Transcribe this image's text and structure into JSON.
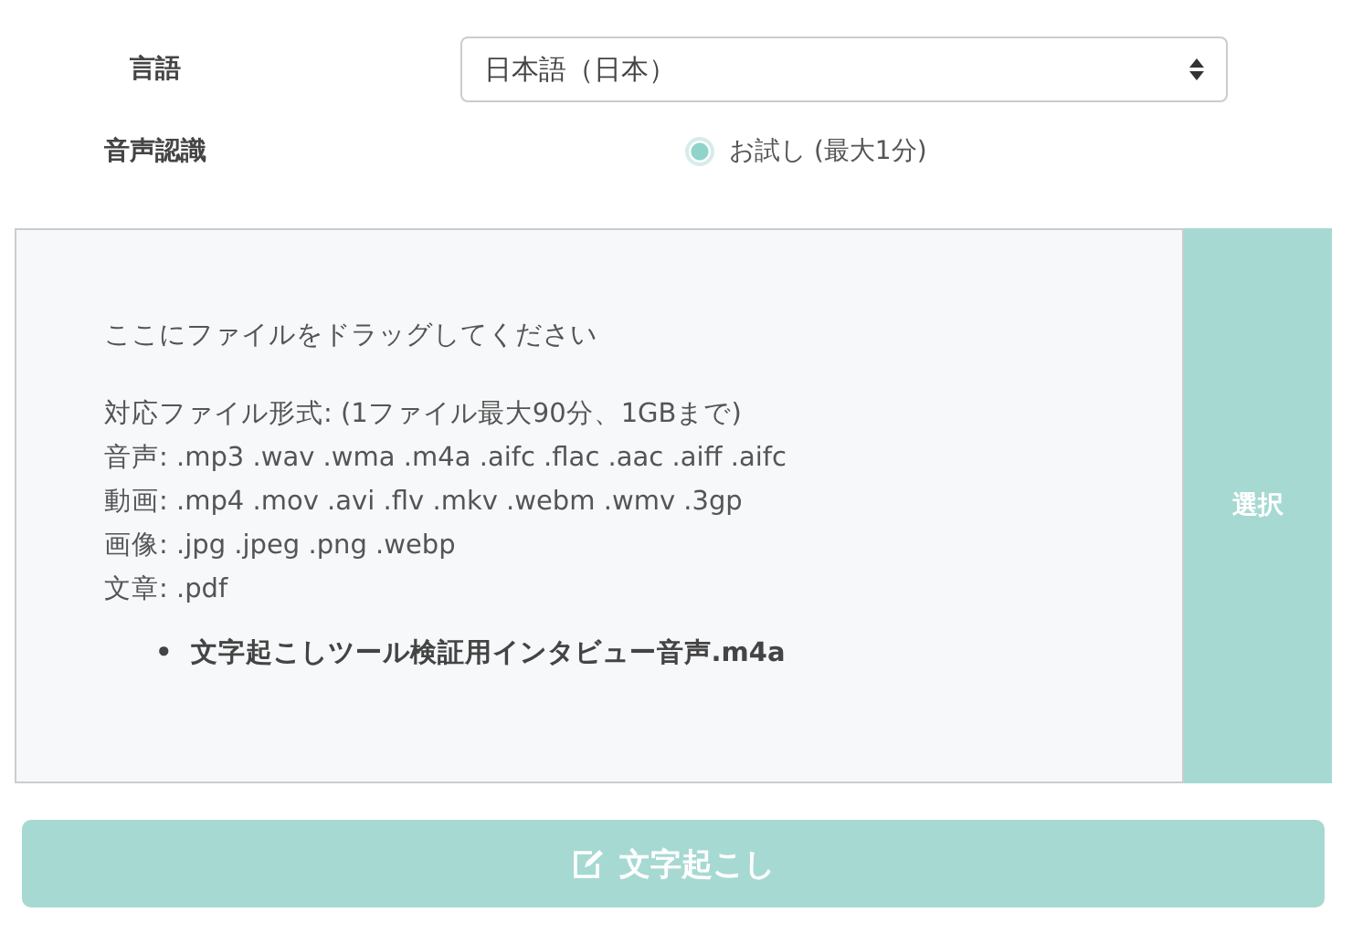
{
  "language": {
    "label": "言語",
    "value": "日本語（日本）"
  },
  "recognition": {
    "label": "音声認識",
    "options": [
      {
        "label": "お試し (最大1分)",
        "selected": true
      }
    ]
  },
  "dropzone": {
    "prompt": "ここにファイルをドラッグしてください",
    "formats": [
      "対応ファイル形式: (1ファイル最大90分、1GBまで)",
      "音声: .mp3 .wav .wma .m4a .aifc .flac .aac .aiff .aifc",
      "動画: .mp4 .mov .avi .flv .mkv .webm .wmv .3gp",
      "画像: .jpg .jpeg .png .webp",
      "文章: .pdf"
    ],
    "files": [
      {
        "bullet": "•",
        "name": "文字起こしツール検証用インタビュー音声.m4a"
      }
    ],
    "select_button": "選択"
  },
  "transcribe_button": {
    "label": "文字起こし",
    "disabled": true
  }
}
